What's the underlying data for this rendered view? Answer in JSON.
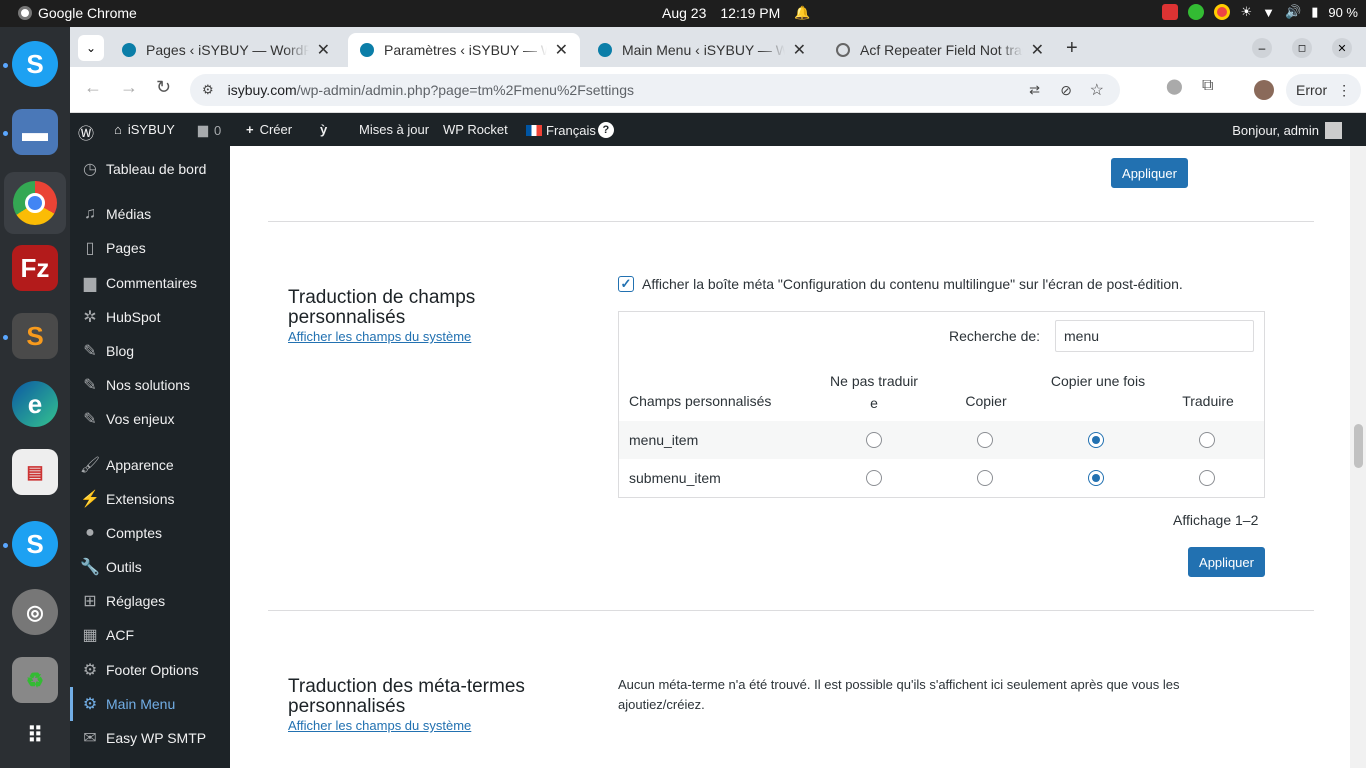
{
  "system": {
    "app_name": "Google Chrome",
    "date": "Aug 23",
    "time": "12:19 PM",
    "battery": "90 %"
  },
  "browser": {
    "tabs": [
      {
        "title": "Pages ‹ iSYBUY — WordPress"
      },
      {
        "title": "Paramètres ‹ iSYBUY — WordPress"
      },
      {
        "title": "Main Menu ‹ iSYBUY — WordPress"
      },
      {
        "title": "Acf Repeater Field Not translated"
      }
    ],
    "url_domain": "isybuy.com",
    "url_path": "/wp-admin/admin.php?page=tm%2Fmenu%2Fsettings",
    "profile_status": "Error"
  },
  "adminbar": {
    "site_name": "iSYBUY",
    "comments_count": "0",
    "new_label": "Créer",
    "updates_label": "Mises à jour",
    "rocket_label": "WP Rocket",
    "language_label": "Français",
    "greeting": "Bonjour, admin"
  },
  "sidebar": {
    "items": [
      {
        "label": "Tableau de bord",
        "icon": "dashboard-icon"
      },
      {
        "label": "Médias",
        "icon": "media-icon"
      },
      {
        "label": "Pages",
        "icon": "pages-icon"
      },
      {
        "label": "Commentaires",
        "icon": "comments-icon"
      },
      {
        "label": "HubSpot",
        "icon": "hubspot-icon"
      },
      {
        "label": "Blog",
        "icon": "pin-icon"
      },
      {
        "label": "Nos solutions",
        "icon": "pin-icon"
      },
      {
        "label": "Vos enjeux",
        "icon": "pin-icon"
      },
      {
        "label": "Apparence",
        "icon": "appearance-icon"
      },
      {
        "label": "Extensions",
        "icon": "plugins-icon"
      },
      {
        "label": "Comptes",
        "icon": "users-icon"
      },
      {
        "label": "Outils",
        "icon": "tools-icon"
      },
      {
        "label": "Réglages",
        "icon": "settings-icon"
      },
      {
        "label": "ACF",
        "icon": "acf-icon"
      },
      {
        "label": "Footer Options",
        "icon": "gear-icon"
      },
      {
        "label": "Main Menu",
        "icon": "gear-icon"
      },
      {
        "label": "Easy WP SMTP",
        "icon": "mail-icon"
      }
    ]
  },
  "main": {
    "apply_label": "Appliquer",
    "custom_fields": {
      "title": "Traduction de champs personnalisés",
      "link": "Afficher les champs du système",
      "checkbox_label": "Afficher la boîte méta \"Configuration du contenu multilingue\" sur l'écran de post-édition.",
      "search_label": "Recherche de:",
      "search_value": "menu",
      "columns": [
        "Champs personnalisés",
        "Ne pas traduire",
        "Copier",
        "Copier une fois",
        "Traduire"
      ],
      "rows": [
        {
          "name": "menu_item",
          "selected": 2
        },
        {
          "name": "submenu_item",
          "selected": 2
        }
      ],
      "pagination": "Affichage 1–2"
    },
    "meta_terms": {
      "title": "Traduction des méta-termes personnalisés",
      "link": "Afficher les champs du système",
      "message": "Aucun méta-terme n'a été trouvé. Il est possible qu'ils s'affichent ici seulement après que vous les ajoutiez/créiez."
    }
  },
  "colors": {
    "wp_dark": "#1d2327",
    "wp_blue": "#2271b1",
    "active_menu": "#72aee6"
  }
}
